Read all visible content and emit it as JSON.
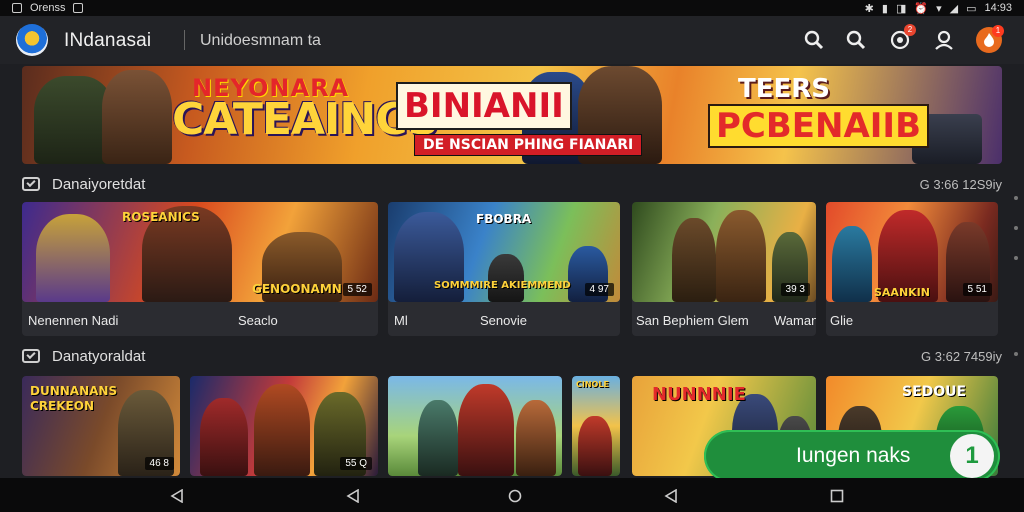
{
  "statusbar": {
    "left_text": "Orenss",
    "time": "14:93"
  },
  "appbar": {
    "title": "INdanasai",
    "subtitle": "Unidoesmnam ta",
    "badges": {
      "notify": "2",
      "profile": "1"
    }
  },
  "hero": {
    "line1": "NEYONARA",
    "line2": "CATEAINCS",
    "line3": "BINIANII",
    "line4": "DE NSCIAN PHING FIANARI",
    "line5": "TEERS",
    "line6": "PCBENAIIB"
  },
  "sections": [
    {
      "title": "Danaiyoretdat",
      "meta": "G 3:66 12S9iy",
      "cards": [
        {
          "logo": "ROSEANICS",
          "badge_text": "GENOONAMN",
          "tag": "5 52",
          "caption_left": "Nenennen Nadi",
          "caption_right": "Seaclo"
        },
        {
          "logo": "FBOBRA",
          "badge_text": "SOMMMIRE AKIEMMEND",
          "tag": "4 97",
          "caption_left": "Ml",
          "caption_right": "Senovie"
        },
        {
          "logo": "",
          "badge_text": "",
          "tag": "39 3",
          "caption_left": "San Bephiem Glem",
          "caption_right": "Waman"
        },
        {
          "logo": "",
          "badge_text": "SAANKIN",
          "tag": "5 51",
          "caption_left": "Glie",
          "caption_right": ""
        }
      ]
    },
    {
      "title": "Danatyoraldat",
      "meta": "G 3:62 7459iy",
      "cards": [
        {
          "logo": "DUNNANANS CREKEON",
          "tag": "46 8"
        },
        {
          "logo": "",
          "tag": "55 Q"
        },
        {
          "logo": "",
          "tag": ""
        },
        {
          "logo": "CINOLE",
          "tag": ""
        },
        {
          "logo": "NUNNNIE",
          "tag": ""
        },
        {
          "logo": "SEDOUE",
          "tag": ""
        }
      ]
    }
  ],
  "toast": {
    "text": "Iungen naks",
    "icon_char": "1"
  },
  "colors": {
    "accent_green": "#1f8e3c",
    "badge_red": "#e8452f",
    "hero_yellow": "#ffd43a"
  }
}
